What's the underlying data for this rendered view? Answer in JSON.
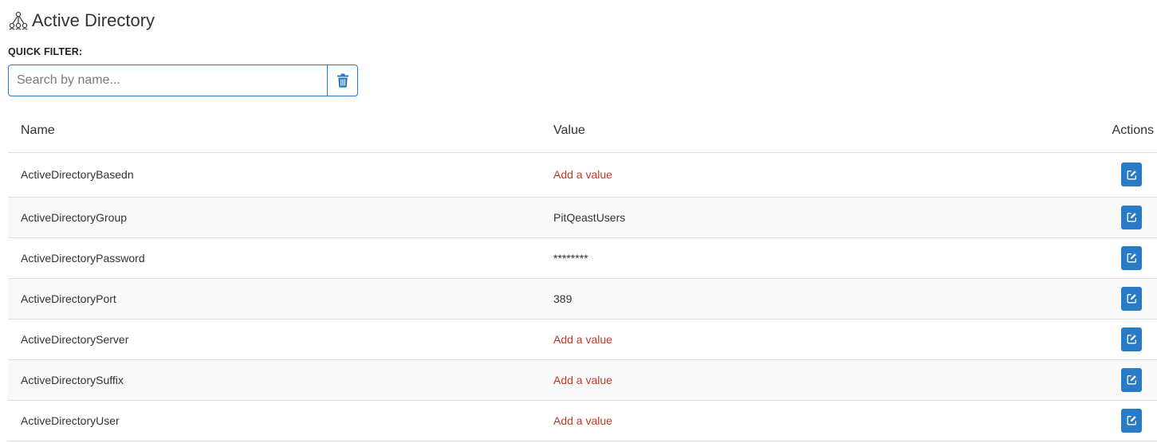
{
  "header": {
    "icon": "network-tree-icon",
    "title": "Active Directory"
  },
  "filter": {
    "label": "QUICK FILTER:",
    "placeholder": "Search by name...",
    "value": "",
    "clear_icon": "trash-icon"
  },
  "table": {
    "columns": {
      "name": "Name",
      "value": "Value",
      "actions": "Actions"
    },
    "rows": [
      {
        "name": "ActiveDirectoryBasedn",
        "value": "Add a value",
        "missing": true
      },
      {
        "name": "ActiveDirectoryGroup",
        "value": "PitQeastUsers",
        "missing": false
      },
      {
        "name": "ActiveDirectoryPassword",
        "value": "********",
        "missing": false
      },
      {
        "name": "ActiveDirectoryPort",
        "value": "389",
        "missing": false
      },
      {
        "name": "ActiveDirectoryServer",
        "value": "Add a value",
        "missing": true
      },
      {
        "name": "ActiveDirectorySuffix",
        "value": "Add a value",
        "missing": true
      },
      {
        "name": "ActiveDirectoryUser",
        "value": "Add a value",
        "missing": true
      }
    ],
    "edit_icon": "edit-icon"
  },
  "colors": {
    "accent": "#2a7bc7",
    "missing_value": "#c0392b"
  }
}
